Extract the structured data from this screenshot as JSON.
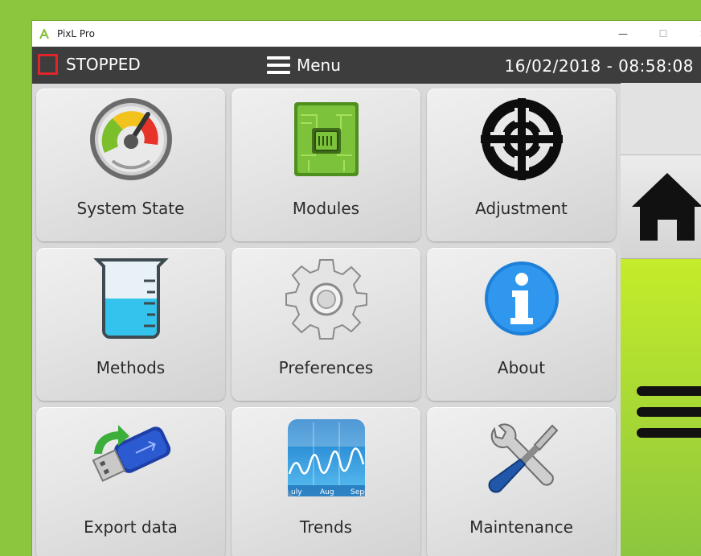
{
  "window": {
    "title": "PixL Pro",
    "controls": {
      "minimize": "—",
      "maximize": "☐",
      "close": "✕"
    }
  },
  "statusbar": {
    "state": "STOPPED",
    "state_color": "#e0242b",
    "menu_label": "Menu",
    "datetime": "16/02/2018 - 08:58:08"
  },
  "tiles": [
    {
      "label": "System State",
      "icon": "speedometer-icon"
    },
    {
      "label": "Modules",
      "icon": "circuit-board-icon"
    },
    {
      "label": "Adjustment",
      "icon": "crosshair-icon"
    },
    {
      "label": "Methods",
      "icon": "beaker-icon"
    },
    {
      "label": "Preferences",
      "icon": "gear-icon"
    },
    {
      "label": "About",
      "icon": "info-icon"
    },
    {
      "label": "Export data",
      "icon": "usb-drive-export-icon"
    },
    {
      "label": "Trends",
      "icon": "trend-chart-icon",
      "months": [
        "uly",
        "Aug",
        "Sep"
      ]
    },
    {
      "label": "Maintenance",
      "icon": "tools-icon"
    }
  ],
  "sidebar": {
    "home": "home-icon",
    "menu": "hamburger-icon"
  },
  "colors": {
    "background": "#8cc63f",
    "statusbar": "#3d3d3d",
    "accent_green": "#c4ec2a"
  }
}
